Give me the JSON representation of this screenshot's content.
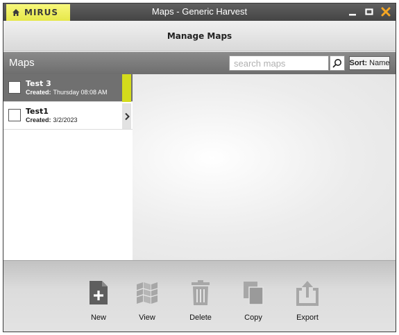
{
  "titlebar": {
    "logo": "MIRUS",
    "title": "Maps - Generic Harvest"
  },
  "header": {
    "title": "Manage Maps"
  },
  "section": {
    "title": "Maps",
    "search_placeholder": "search maps",
    "sort_label": "Sort:",
    "sort_value": "Name"
  },
  "maps": [
    {
      "name": "Test 3",
      "created_label": "Created:",
      "created": "Thursday 08:08 AM",
      "selected": true
    },
    {
      "name": "Test1",
      "created_label": "Created:",
      "created": "3/2/2023",
      "selected": false
    }
  ],
  "toolbar": {
    "new": "New",
    "view": "View",
    "delete": "Delete",
    "copy": "Copy",
    "export": "Export"
  },
  "colors": {
    "accent": "#d4dc1c",
    "logo_tab": "#e6e74a",
    "close_button": "#f5a623",
    "icon_active": "#5e5e5e",
    "icon_disabled": "#a7a7a7"
  }
}
